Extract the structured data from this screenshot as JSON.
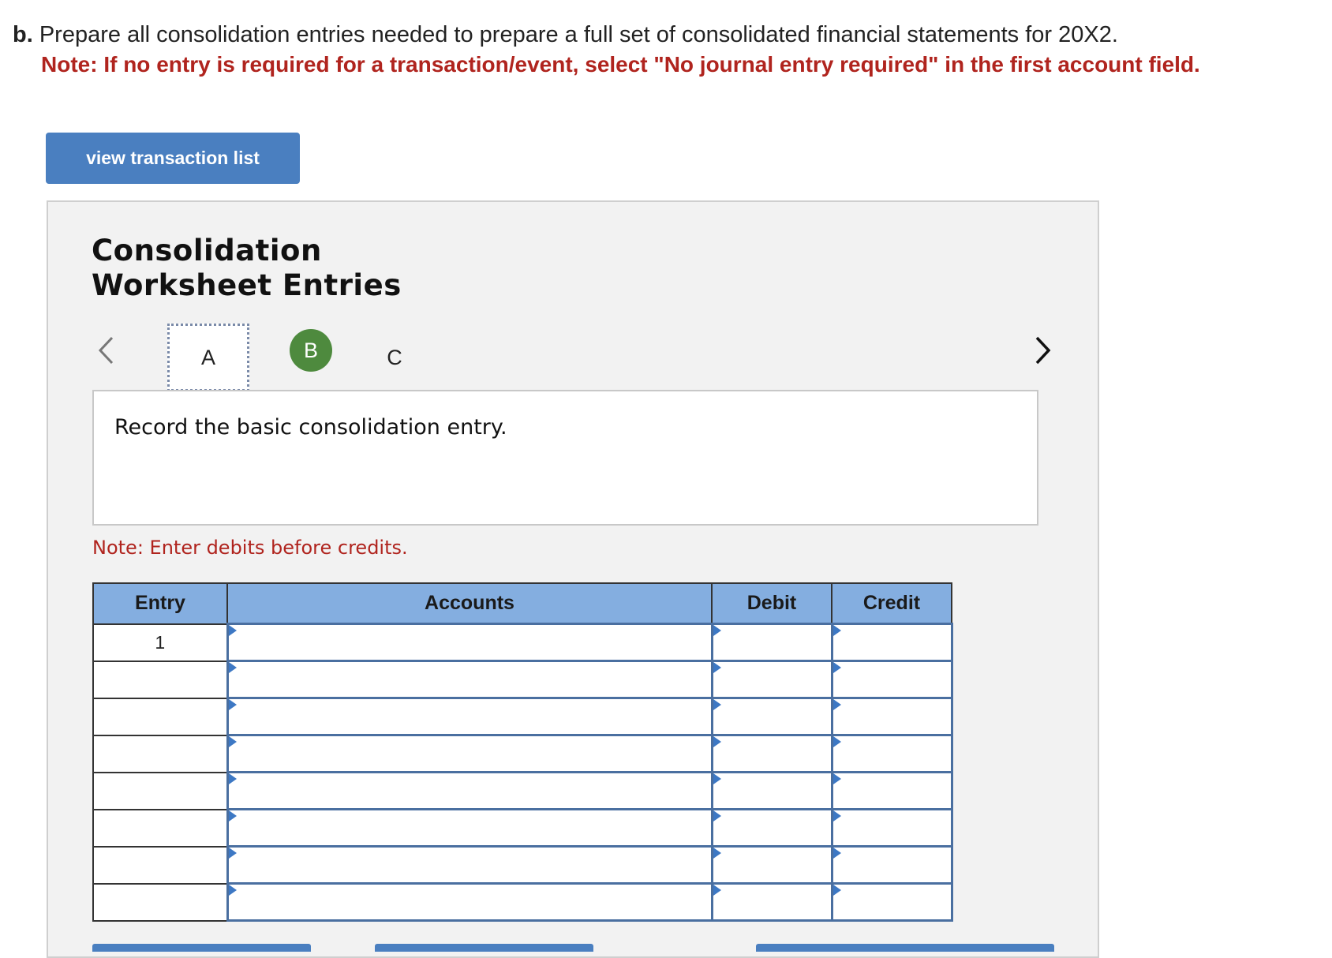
{
  "question": {
    "prefix": "b.",
    "text": "Prepare all consolidation entries needed to prepare a full set of consolidated financial statements for 20X2.",
    "note": "Note: If no entry is required for a transaction/event, select \"No journal entry required\" in the first account field."
  },
  "view_button_label": "view transaction list",
  "panel": {
    "title_line1": "Consolidation",
    "title_line2": "Worksheet Entries",
    "tabs": [
      {
        "label": "A",
        "state": "focused"
      },
      {
        "label": "B",
        "state": "completed"
      },
      {
        "label": "C",
        "state": "default"
      }
    ],
    "instruction": "Record the basic consolidation entry.",
    "note": "Note: Enter debits before credits."
  },
  "table": {
    "headers": {
      "entry": "Entry",
      "accounts": "Accounts",
      "debit": "Debit",
      "credit": "Credit"
    },
    "rows": [
      {
        "entry": "1",
        "account": "",
        "debit": "",
        "credit": ""
      },
      {
        "entry": "",
        "account": "",
        "debit": "",
        "credit": ""
      },
      {
        "entry": "",
        "account": "",
        "debit": "",
        "credit": ""
      },
      {
        "entry": "",
        "account": "",
        "debit": "",
        "credit": ""
      },
      {
        "entry": "",
        "account": "",
        "debit": "",
        "credit": ""
      },
      {
        "entry": "",
        "account": "",
        "debit": "",
        "credit": ""
      },
      {
        "entry": "",
        "account": "",
        "debit": "",
        "credit": ""
      },
      {
        "entry": "",
        "account": "",
        "debit": "",
        "credit": ""
      }
    ]
  },
  "colors": {
    "accent_button": "#4a7fc0",
    "note_red": "#b0241e",
    "header_blue": "#84aee0",
    "tab_complete_green": "#4e8a3e"
  },
  "icons": {
    "prev": "chevron-left-icon",
    "next": "chevron-right-icon",
    "dropdown_marker": "triangle-marker-icon"
  }
}
